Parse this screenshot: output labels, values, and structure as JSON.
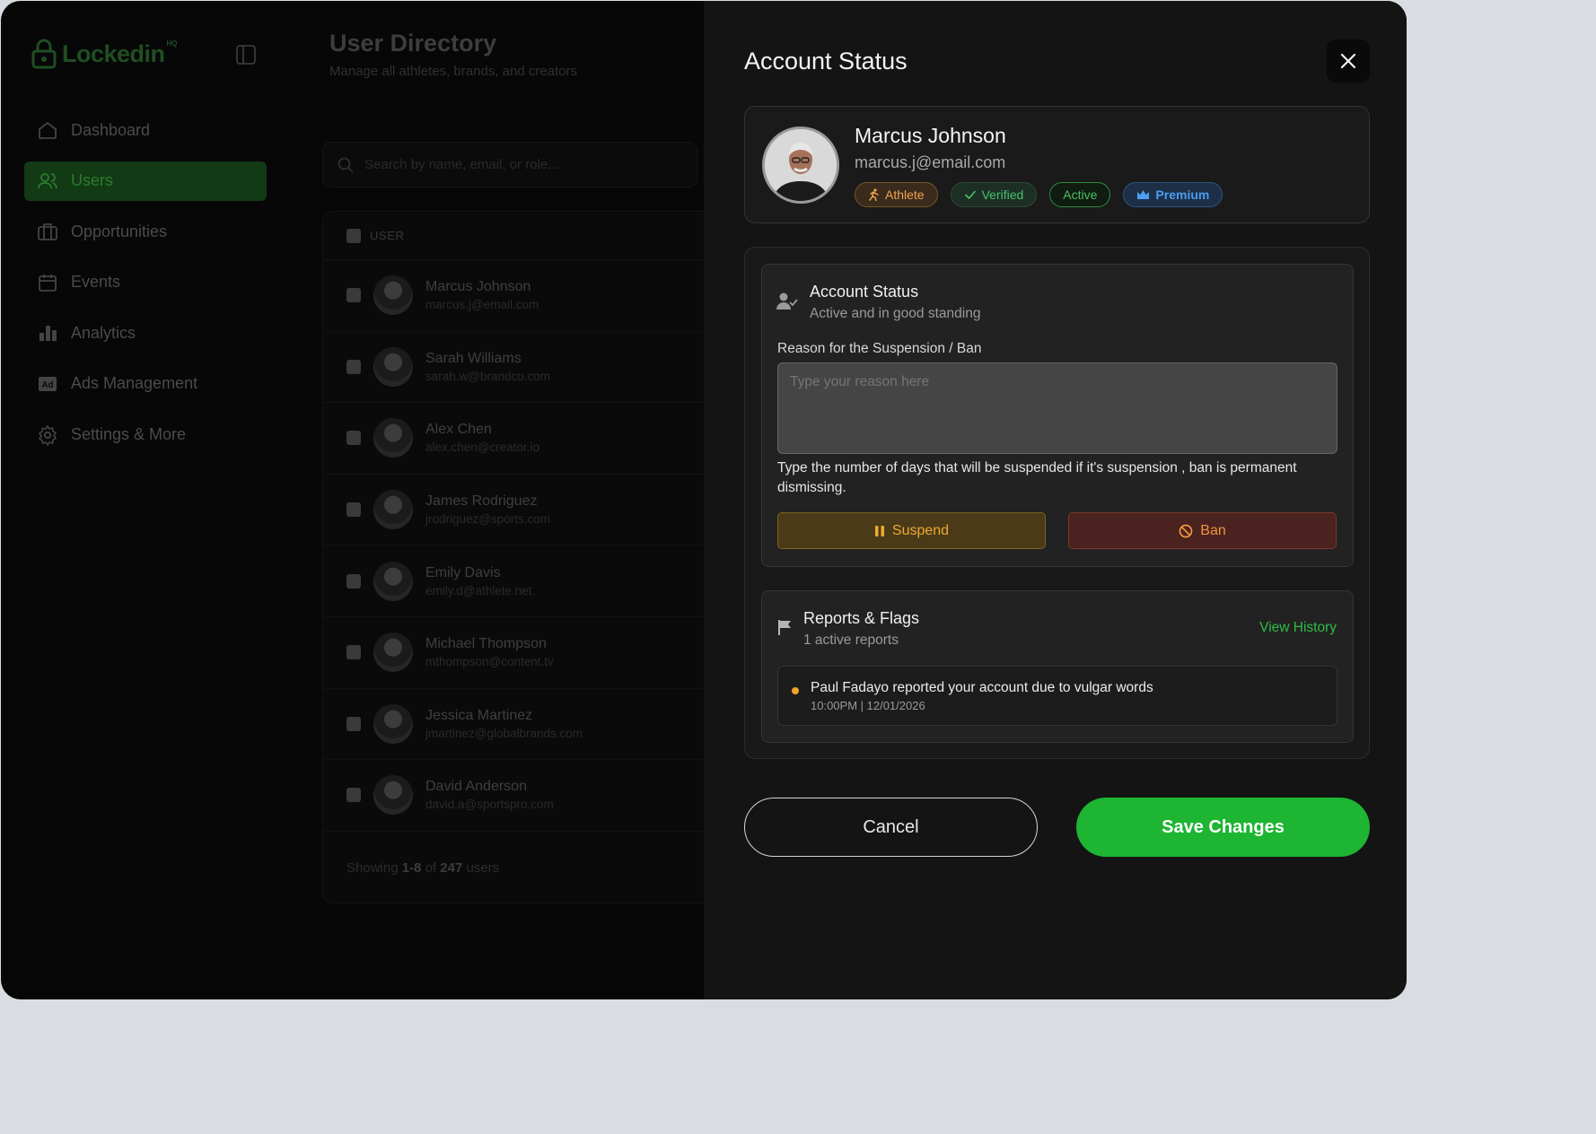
{
  "app": {
    "logo_text": "Lockedin",
    "logo_sup": "HQ"
  },
  "sidebar": {
    "items": [
      {
        "label": "Dashboard",
        "icon": "home-icon",
        "active": false
      },
      {
        "label": "Users",
        "icon": "users-icon",
        "active": true
      },
      {
        "label": "Opportunities",
        "icon": "briefcase-icon",
        "active": false
      },
      {
        "label": "Events",
        "icon": "calendar-icon",
        "active": false
      },
      {
        "label": "Analytics",
        "icon": "bar-chart-icon",
        "active": false
      },
      {
        "label": "Ads Management",
        "icon": "ad-icon",
        "active": false
      },
      {
        "label": "Settings & More",
        "icon": "gear-icon",
        "active": false
      }
    ]
  },
  "directory": {
    "title": "User Directory",
    "subtitle": "Manage all athletes, brands, and creators",
    "search_placeholder": "Search by name, email, or role...",
    "column_user": "USER",
    "rows": [
      {
        "name": "Marcus Johnson",
        "email": "marcus.j@email.com"
      },
      {
        "name": "Sarah Williams",
        "email": "sarah.w@brandco.com"
      },
      {
        "name": "Alex Chen",
        "email": "alex.chen@creator.io"
      },
      {
        "name": "James Rodriguez",
        "email": "jrodriguez@sports.com"
      },
      {
        "name": "Emily Davis",
        "email": "emily.d@athlete.net"
      },
      {
        "name": "Michael Thompson",
        "email": "mthompson@content.tv"
      },
      {
        "name": "Jessica Martinez",
        "email": "jmartinez@globalbrands.com"
      },
      {
        "name": "David Anderson",
        "email": "david.a@sportspro.com"
      }
    ],
    "footer": {
      "prefix": "Showing",
      "range": "1-8",
      "of": "of",
      "total": "247",
      "suffix": "users"
    }
  },
  "modal": {
    "title": "Account Status",
    "user": {
      "name": "Marcus Johnson",
      "email": "marcus.j@email.com",
      "badges": {
        "role": "Athlete",
        "verified": "Verified",
        "status": "Active",
        "tier": "Premium"
      }
    },
    "account_status": {
      "title": "Account Status",
      "subtitle": "Active and in good standing",
      "reason_label": "Reason for the Suspension / Ban",
      "reason_placeholder": "Type your reason here",
      "hint": "Type the number of days that will be suspended if it's suspension , ban is permanent dismissing.",
      "suspend_label": "Suspend",
      "ban_label": "Ban"
    },
    "reports": {
      "title": "Reports & Flags",
      "subtitle": "1 active reports",
      "view_history": "View History",
      "items": [
        {
          "text": "Paul Fadayo reported your account due to vulgar words",
          "time": "10:00PM | 12/01/2026"
        }
      ]
    },
    "cancel_label": "Cancel",
    "save_label": "Save Changes"
  },
  "colors": {
    "accent": "#1db532",
    "warning": "#f0aa30",
    "danger": "#f0953c",
    "premium": "#4c9cf2"
  }
}
